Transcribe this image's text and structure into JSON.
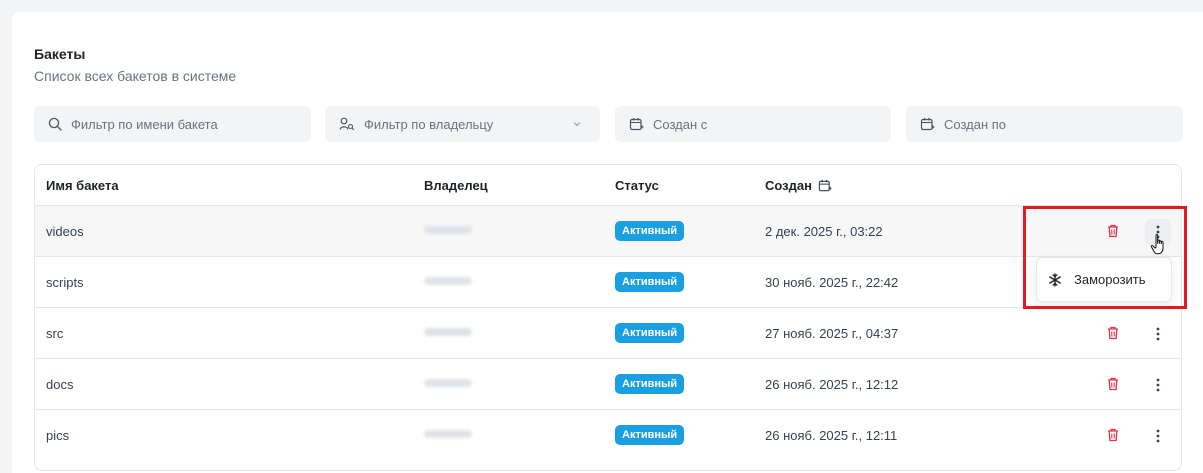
{
  "page": {
    "title": "Бакеты",
    "subtitle": "Список всех бакетов в системе"
  },
  "filters": {
    "name_placeholder": "Фильтр по имени бакета",
    "owner_placeholder": "Фильтр по владельцу",
    "created_from_placeholder": "Создан с",
    "created_to_placeholder": "Создан по"
  },
  "table": {
    "headers": {
      "name": "Имя бакета",
      "owner": "Владелец",
      "status": "Статус",
      "created": "Создан"
    },
    "rows": [
      {
        "name": "videos",
        "status": "Активный",
        "created": "2 дек. 2025 г., 03:22"
      },
      {
        "name": "scripts",
        "status": "Активный",
        "created": "30 нояб. 2025 г., 22:42"
      },
      {
        "name": "src",
        "status": "Активный",
        "created": "27 нояб. 2025 г., 04:37"
      },
      {
        "name": "docs",
        "status": "Активный",
        "created": "26 нояб. 2025 г., 12:12"
      },
      {
        "name": "pics",
        "status": "Активный",
        "created": "26 нояб. 2025 г., 12:11"
      }
    ]
  },
  "context_menu": {
    "freeze_label": "Заморозить"
  },
  "colors": {
    "badge": "#1a9fe0",
    "delete": "#e2334a",
    "highlight": "#e11b22"
  },
  "icons": {
    "search": "search-icon",
    "owner": "user-search-icon",
    "calendar": "calendar-icon",
    "chevron": "chevron-down-icon",
    "delete": "trash-icon",
    "more": "more-vertical-icon",
    "freeze": "snowflake-icon",
    "cursor": "hand-pointer-icon"
  }
}
